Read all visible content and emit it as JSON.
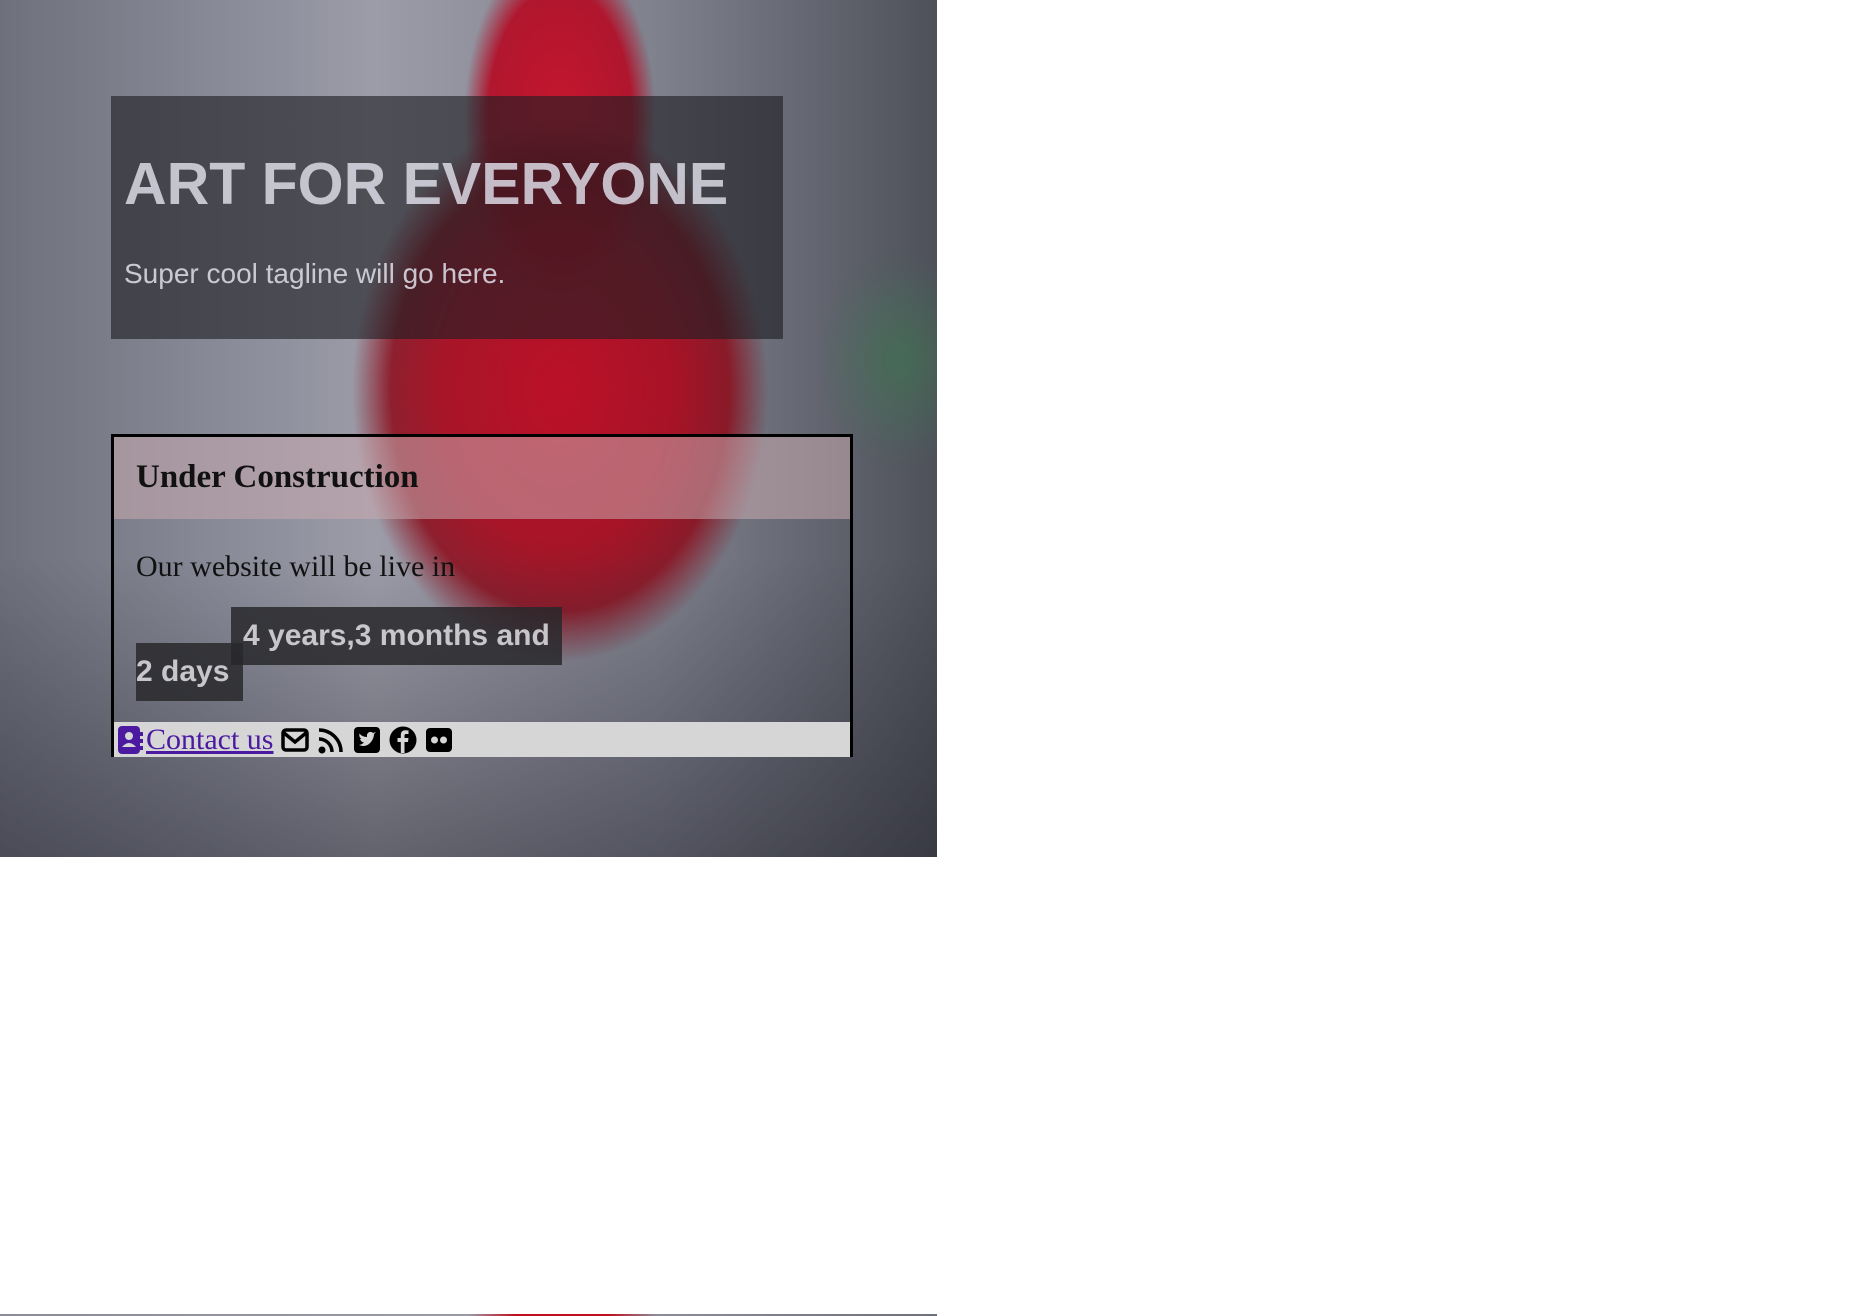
{
  "hero": {
    "title": "ART FOR EVERYONE",
    "tagline": "Super cool tagline will go here."
  },
  "card": {
    "title": "Under Construction",
    "text": "Our website will be live in",
    "countdown_line1": "4 years,3 months and",
    "countdown_line2": "2 days"
  },
  "footer": {
    "contact_label": " Contact us",
    "contact_icon": "contact-card-icon",
    "social_icons": [
      "envelope-icon",
      "rss-icon",
      "twitter-icon",
      "facebook-icon",
      "flickr-icon"
    ]
  },
  "colors": {
    "link": "#4b1aa0",
    "footer_bg": "#d6d6d6",
    "rose": "#c01020"
  }
}
